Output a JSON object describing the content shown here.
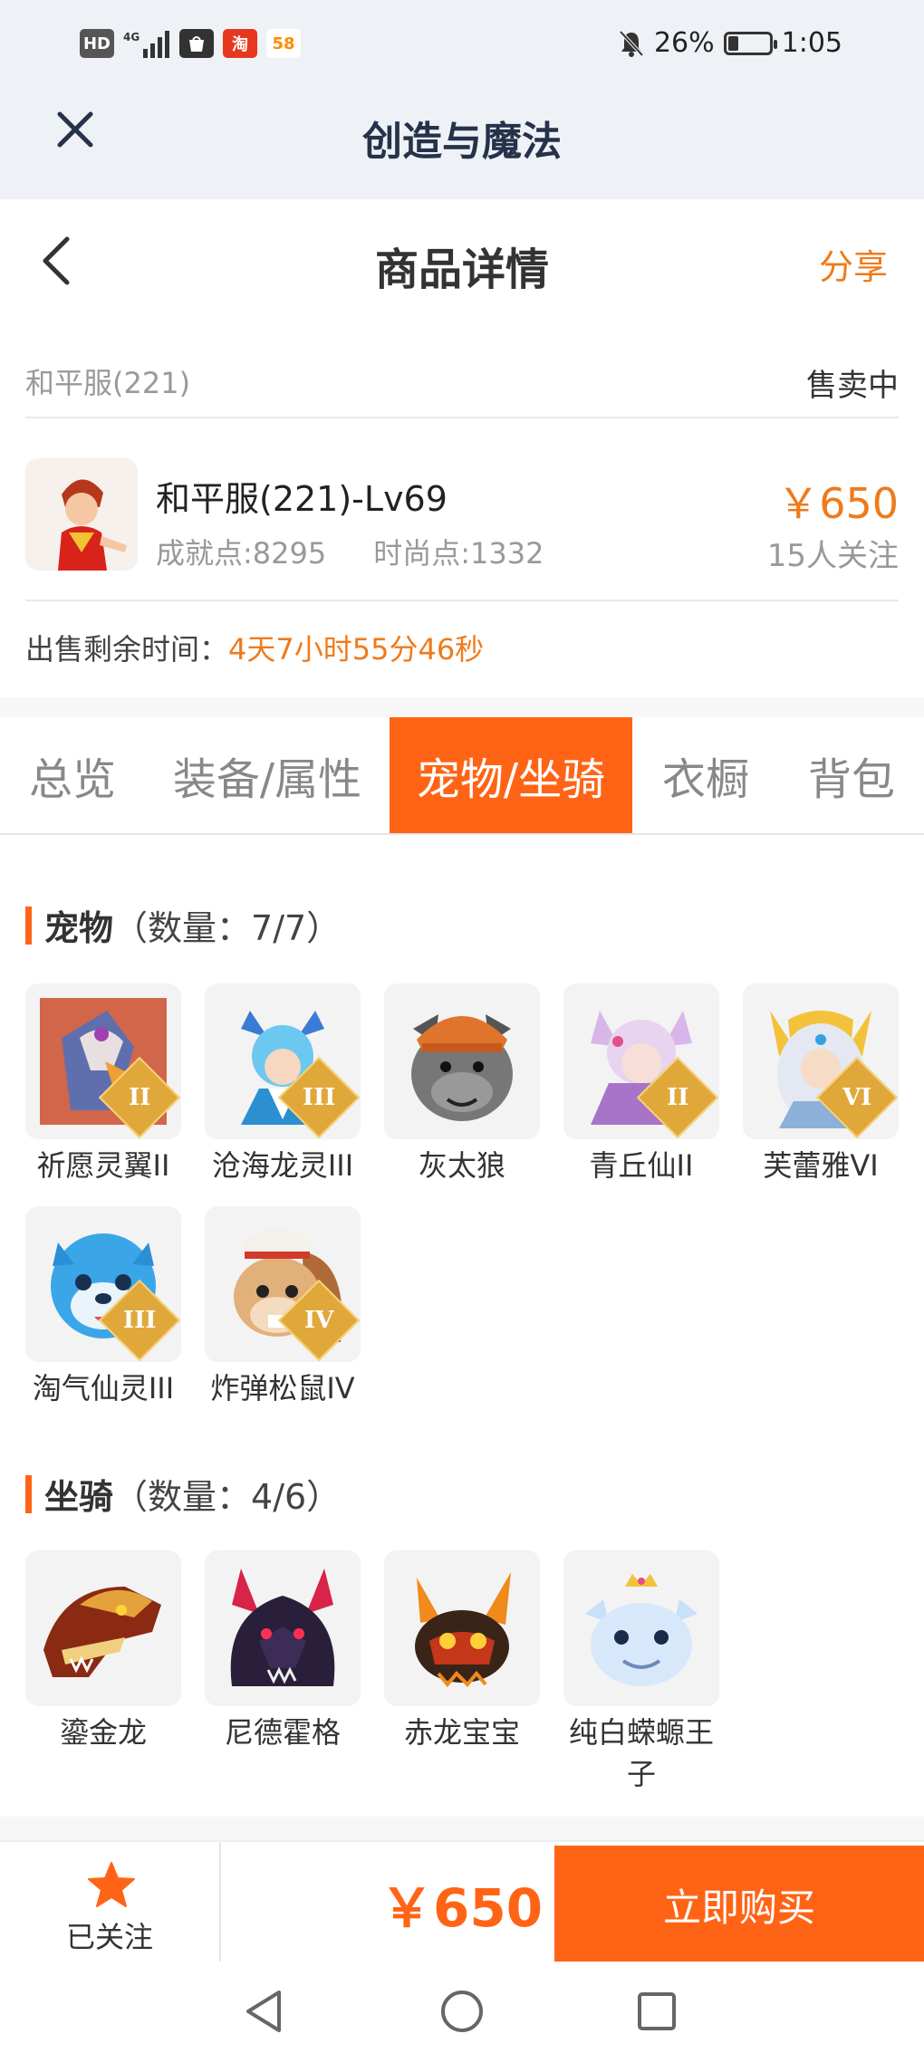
{
  "status_bar": {
    "left_icons": [
      "hd-icon",
      "4g-signal-icon",
      "bag-app-icon",
      "taobao-app-icon",
      "58-app-icon"
    ],
    "hd": "HD",
    "tao": "淘",
    "num58": "58",
    "battery": "26%",
    "battery_level": 0.26,
    "time": "1:05"
  },
  "app_bar": {
    "title": "创造与魔法"
  },
  "nav_bar": {
    "title": "商品详情",
    "share": "分享"
  },
  "listing": {
    "server": "和平服(221)",
    "status": "售卖中",
    "name": "和平服(221)-Lv69",
    "achievement": "成就点:8295",
    "fashion": "时尚点:1332",
    "price": "￥650",
    "followers": "15人关注",
    "countdown_label": "出售剩余时间：",
    "countdown_value": "4天7小时55分46秒"
  },
  "tabs": [
    {
      "label": "总览"
    },
    {
      "label": "装备/属性"
    },
    {
      "label": "宠物/坐骑",
      "active": true
    },
    {
      "label": "衣橱"
    },
    {
      "label": "背包"
    }
  ],
  "pets": {
    "title": "宠物",
    "count": "（数量：7/7）",
    "items": [
      {
        "name": "祈愿灵翼II",
        "grade": "II"
      },
      {
        "name": "沧海龙灵III",
        "grade": "III"
      },
      {
        "name": "灰太狼",
        "grade": ""
      },
      {
        "name": "青丘仙II",
        "grade": "II"
      },
      {
        "name": "芙蕾雅VI",
        "grade": "VI"
      },
      {
        "name": "淘气仙灵III",
        "grade": "III"
      },
      {
        "name": "炸弹松鼠IV",
        "grade": "IV"
      }
    ]
  },
  "mounts": {
    "title": "坐骑",
    "count": "（数量：4/6）",
    "items": [
      {
        "name": "鎏金龙"
      },
      {
        "name": "尼德霍格"
      },
      {
        "name": "赤龙宝宝"
      },
      {
        "name": "纯白蝾螈王子"
      }
    ]
  },
  "bottom_bar": {
    "follow_label": "已关注",
    "price": "￥650",
    "buy_label": "立即购买"
  },
  "colors": {
    "accent": "#ff6416",
    "price": "#f07a1a",
    "header_bg": "#eef2f7"
  }
}
